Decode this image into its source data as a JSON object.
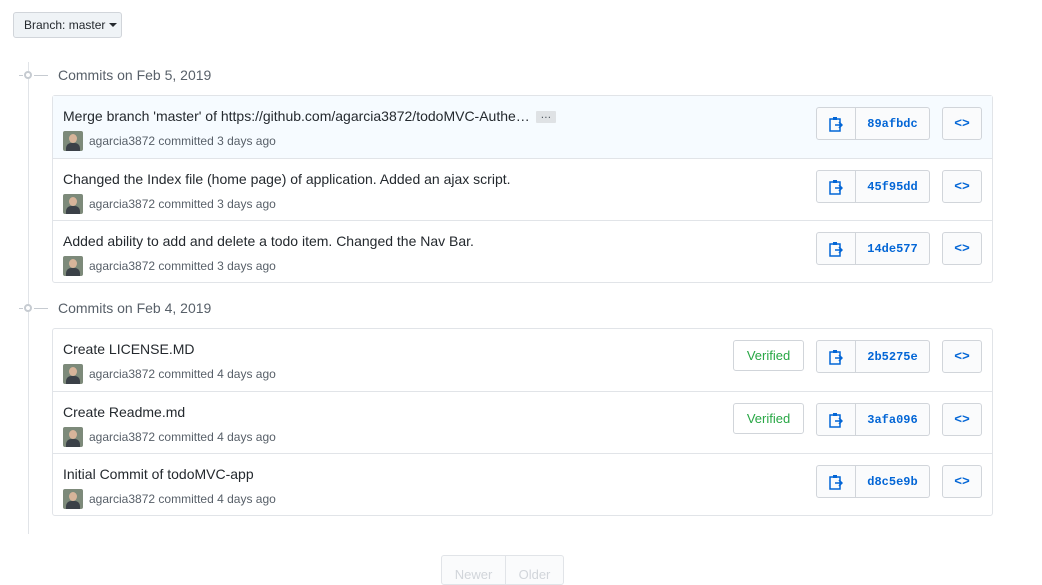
{
  "branch": {
    "label": "Branch:",
    "name": "master"
  },
  "groups": [
    {
      "heading": "Commits on Feb 5, 2019",
      "commits": [
        {
          "message": "Merge branch 'master' of https://github.com/agarcia3872/todoMVC-Authe…",
          "user": "agarcia3872",
          "when": "committed 3 days ago",
          "sha": "89afbdc",
          "verified": "",
          "ellipsis": "…"
        },
        {
          "message": "Changed the Index file (home page) of application. Added an ajax script.",
          "user": "agarcia3872",
          "when": "committed 3 days ago",
          "sha": "45f95dd",
          "verified": ""
        },
        {
          "message": "Added ability to add and delete a todo item. Changed the Nav Bar.",
          "user": "agarcia3872",
          "when": "committed 3 days ago",
          "sha": "14de577",
          "verified": ""
        }
      ]
    },
    {
      "heading": "Commits on Feb 4, 2019",
      "commits": [
        {
          "message": "Create LICENSE.MD",
          "user": "agarcia3872",
          "when": "committed 4 days ago",
          "sha": "2b5275e",
          "verified": "Verified"
        },
        {
          "message": "Create Readme.md",
          "user": "agarcia3872",
          "when": "committed 4 days ago",
          "sha": "3afa096",
          "verified": "Verified"
        },
        {
          "message": "Initial Commit of todoMVC-app",
          "user": "agarcia3872",
          "when": "committed 4 days ago",
          "sha": "d8c5e9b",
          "verified": ""
        }
      ]
    }
  ],
  "browse_symbol": "<>",
  "pagination": {
    "newer": "Newer",
    "older": "Older"
  },
  "colors": {
    "link": "#0366d6",
    "verified": "#28a745",
    "border": "#e1e4e8"
  }
}
